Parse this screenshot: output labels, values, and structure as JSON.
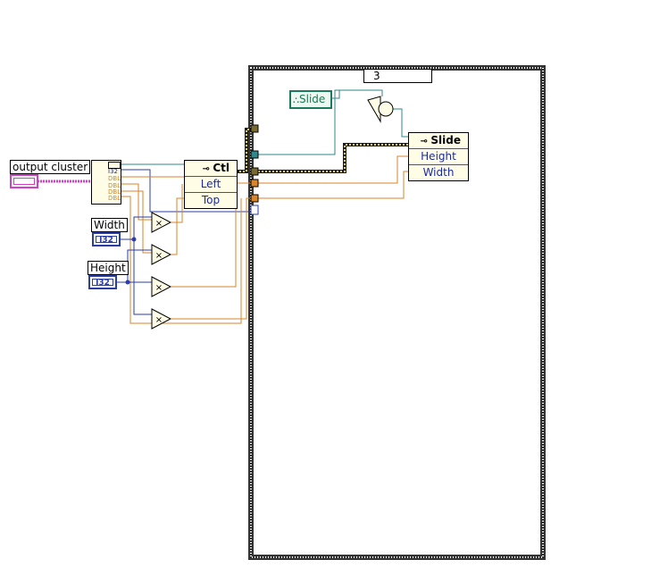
{
  "output_cluster": {
    "label": "output cluster"
  },
  "width_terminal": {
    "label": "Width",
    "type": "I32"
  },
  "height_terminal": {
    "label": "Height",
    "type": "I32"
  },
  "unbundle": {
    "rows": [
      "I32",
      "DBL",
      "DBL",
      "DBL",
      "DBL"
    ]
  },
  "ctl_property_node": {
    "title": "Ctl",
    "properties": [
      "Left",
      "Top"
    ]
  },
  "case_structure": {
    "selector_value": "3"
  },
  "slide_reference": {
    "label": "Slide"
  },
  "slide_property_node": {
    "title": "Slide",
    "properties": [
      "Height",
      "Width"
    ]
  },
  "colors": {
    "wire_orange": "#d9852a",
    "wire_blue": "#1f3fa8",
    "wire_teal": "#2e8a8a",
    "wire_pink": "#d040c8",
    "ref_green": "#1a7a5a",
    "node_bg": "#fffde6"
  }
}
